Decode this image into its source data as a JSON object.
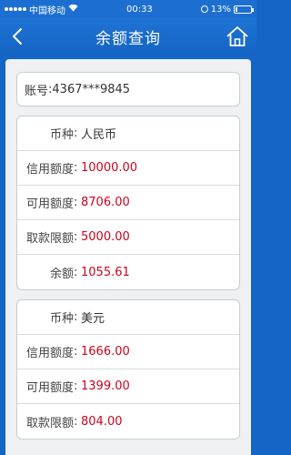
{
  "status_bar": {
    "carrier": "中国移动",
    "time": "00:33",
    "battery": "13%",
    "battery_level": 0.13
  },
  "nav": {
    "title": "余额查询"
  },
  "account": {
    "label": "账号",
    "value": "4367***9845"
  },
  "cards": [
    {
      "rows": [
        {
          "label": "币种",
          "value": "人民币"
        },
        {
          "label": "信用额度",
          "value": "10000.00"
        },
        {
          "label": "可用额度",
          "value": "8706.00"
        },
        {
          "label": "取款限额",
          "value": "5000.00"
        },
        {
          "label": "余额",
          "value": "1055.61"
        }
      ]
    },
    {
      "rows": [
        {
          "label": "币种",
          "value": "美元"
        },
        {
          "label": "信用额度",
          "value": "1666.00"
        },
        {
          "label": "可用额度",
          "value": "1399.00"
        },
        {
          "label": "取款限额",
          "value": "804.00"
        }
      ]
    }
  ],
  "colors": {
    "nav_blue": "#1c6fd0",
    "value_red": "#d0021b"
  }
}
